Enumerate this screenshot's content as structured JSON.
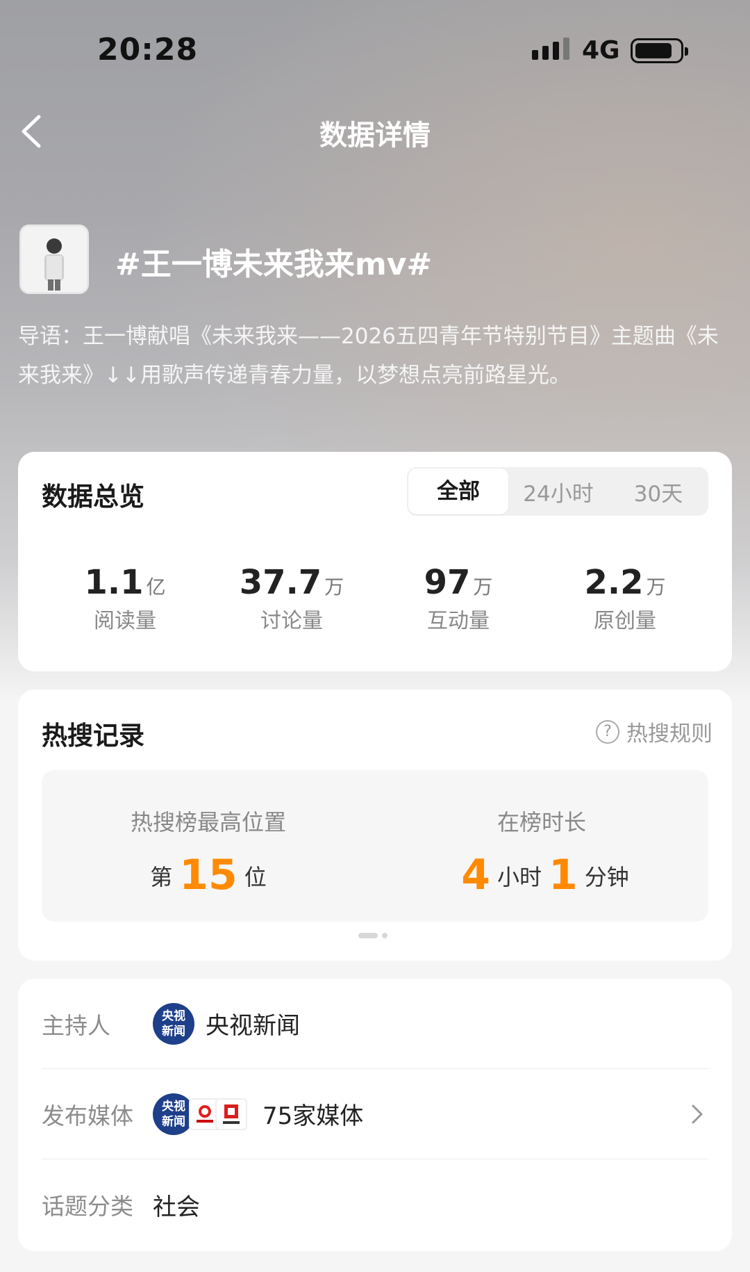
{
  "status_bar": {
    "time": "20:28",
    "network": "4G"
  },
  "nav": {
    "title": "数据详情"
  },
  "topic": {
    "title": "#王一博未来我来mv#",
    "intro": "导语：王一博献唱《未来我来——2026五四青年节特别节目》主题曲《未来我来》↓↓用歌声传递青春力量，以梦想点亮前路星光。"
  },
  "overview": {
    "title": "数据总览",
    "tabs": [
      "全部",
      "24小时",
      "30天"
    ],
    "active_tab": "全部",
    "stats": [
      {
        "value": "1.1",
        "unit": "亿",
        "label": "阅读量"
      },
      {
        "value": "37.7",
        "unit": "万",
        "label": "讨论量"
      },
      {
        "value": "97",
        "unit": "万",
        "label": "互动量"
      },
      {
        "value": "2.2",
        "unit": "万",
        "label": "原创量"
      }
    ]
  },
  "hot_search": {
    "title": "热搜记录",
    "rule_label": "热搜规则",
    "peak_label": "热搜榜最高位置",
    "peak_prefix": "第",
    "peak_value": "15",
    "peak_suffix": "位",
    "duration_label": "在榜时长",
    "hours": "4",
    "hours_unit": "小时",
    "minutes": "1",
    "minutes_unit": "分钟"
  },
  "info": {
    "host_label": "主持人",
    "host_name": "央视新闻",
    "host_logo_text": "央视新闻",
    "media_label": "发布媒体",
    "media_count": "75家媒体",
    "category_label": "话题分类",
    "category_value": "社会"
  },
  "colors": {
    "accent": "#ff8a00",
    "card": "#ffffff",
    "muted": "#888888"
  },
  "icons": [
    "back-arrow-icon",
    "question-icon",
    "chevron-right-icon",
    "signal-icon",
    "battery-icon"
  ]
}
